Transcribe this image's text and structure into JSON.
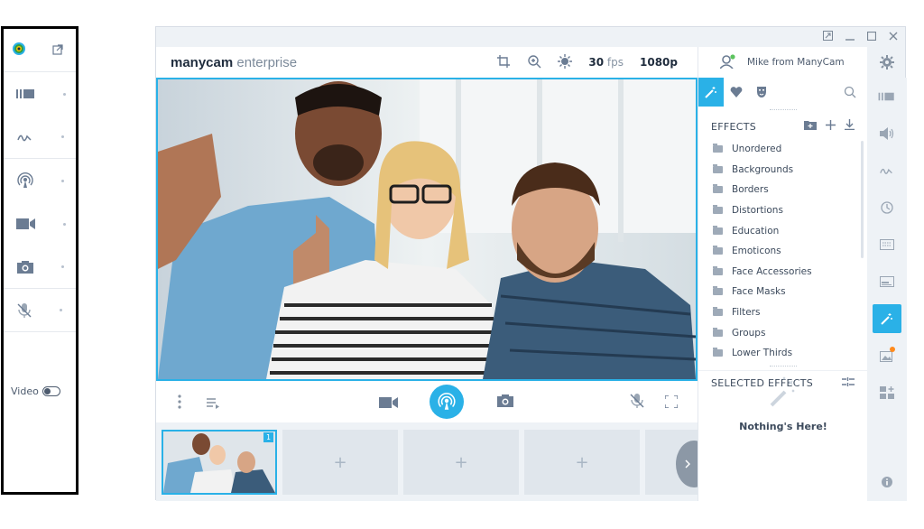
{
  "mini_panel": {
    "video_label": "Video"
  },
  "window": {
    "logo_bold": "manycam",
    "logo_light": " enterprise",
    "fps_value": "30",
    "fps_unit": "fps",
    "resolution": "1080p"
  },
  "user": {
    "name": "Mike from ManyCam"
  },
  "effects_panel": {
    "title": "EFFECTS",
    "folders": [
      {
        "label": "Unordered"
      },
      {
        "label": "Backgrounds"
      },
      {
        "label": "Borders"
      },
      {
        "label": "Distortions"
      },
      {
        "label": "Education"
      },
      {
        "label": "Emoticons"
      },
      {
        "label": "Face Accessories"
      },
      {
        "label": "Face Masks"
      },
      {
        "label": "Filters"
      },
      {
        "label": "Groups"
      },
      {
        "label": "Lower Thirds"
      }
    ],
    "selected_title": "SELECTED EFFECTS",
    "empty_text": "Nothing's Here!"
  },
  "thumbnails": {
    "active_badge": "1",
    "add_symbol": "+"
  },
  "colors": {
    "accent": "#2ab1e7",
    "notification": "#ff8a1c"
  }
}
